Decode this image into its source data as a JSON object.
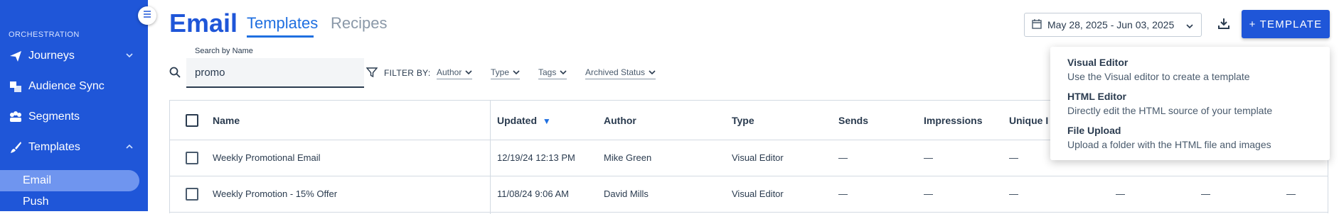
{
  "sidebar": {
    "section_label": "ORCHESTRATION",
    "items": [
      {
        "label": "Journeys",
        "icon": "paper-plane-icon",
        "expandable": true
      },
      {
        "label": "Audience Sync",
        "icon": "audience-sync-icon"
      },
      {
        "label": "Segments",
        "icon": "segments-icon"
      },
      {
        "label": "Templates",
        "icon": "brush-icon",
        "expanded": true
      }
    ],
    "sub_items": [
      {
        "label": "Email",
        "active": true
      },
      {
        "label": "Push"
      }
    ]
  },
  "header": {
    "title": "Email",
    "tabs": [
      {
        "label": "Templates",
        "active": true
      },
      {
        "label": "Recipes",
        "active": false
      }
    ],
    "date_range": "May 28, 2025 - Jun 03, 2025",
    "new_template_label": "+ TEMPLATE"
  },
  "search": {
    "label": "Search by Name",
    "value": "promo"
  },
  "filters": {
    "label": "FILTER BY:",
    "items": [
      "Author",
      "Type",
      "Tags",
      "Archived Status"
    ]
  },
  "table": {
    "columns": [
      "Name",
      "Updated",
      "Author",
      "Type",
      "Sends",
      "Impressions",
      "Unique I"
    ],
    "sort_indicator": "▼",
    "rows": [
      {
        "name": "Weekly Promotional Email",
        "updated": "12/19/24 12:13 PM",
        "author": "Mike Green",
        "type": "Visual Editor",
        "sends": "—",
        "impressions": "—",
        "unique": "—"
      },
      {
        "name": "Weekly Promotion - 15% Offer",
        "updated": "11/08/24 9:06 AM",
        "author": "David Mills",
        "type": "Visual Editor",
        "sends": "—",
        "impressions": "—",
        "unique": "—",
        "extra": [
          "—",
          "—",
          "—"
        ]
      }
    ]
  },
  "template_menu": [
    {
      "title": "Visual Editor",
      "desc": "Use the Visual editor to create a template"
    },
    {
      "title": "HTML Editor",
      "desc": "Directly edit the HTML source of your template"
    },
    {
      "title": "File Upload",
      "desc": "Upload a folder with the HTML file and images"
    }
  ],
  "colors": {
    "brand": "#1f56d8",
    "accent": "#1f6fe0"
  }
}
